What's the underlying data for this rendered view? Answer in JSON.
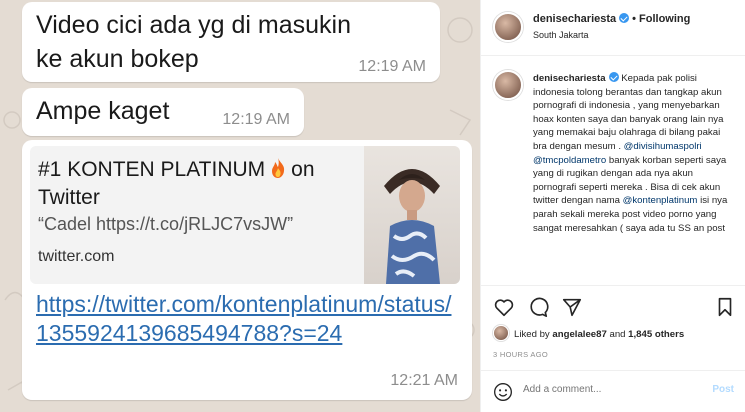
{
  "chat": {
    "messages": [
      {
        "text": "Video cici ada yg di masukin ke akun bokep",
        "time": "12:19 AM"
      },
      {
        "text": "Ampe kaget",
        "time": "12:19 AM"
      }
    ],
    "link_message": {
      "preview_title": "#1 KONTEN PLATINUM",
      "preview_title_suffix": "on Twitter",
      "preview_description": "“Cadel https://t.co/jRLJC7vsJW”",
      "preview_domain": "twitter.com",
      "url": "https://twitter.com/kontenplatinum/status/1355924139685494788?s=24",
      "time": "12:21 AM"
    }
  },
  "instagram": {
    "username": "denisechariesta",
    "separator": "•",
    "follow_status": "Following",
    "location": "South Jakarta",
    "caption": {
      "author": "denisechariesta",
      "part1": "Kepada pak polisi indonesia tolong berantas dan tangkap akun pornografi di indonesia , yang menyebarkan hoax konten saya dan banyak orang lain nya yang memakai baju olahraga di bilang pakai bra dengan mesum .",
      "mention1": "@divisihumaspolri",
      "mention2": "@tmcpoldametro",
      "part2": "banyak korban seperti saya yang di rugikan dengan ada nya akun pornografi seperti mereka . Bisa di cek akun twitter dengan nama",
      "mention3": "@kontenplatinum",
      "part3": "isi nya parah sekali mereka post video porno yang sangat meresahkan ( saya ada tu SS an post"
    },
    "likes": {
      "prefix": "Liked by",
      "user": "angelalee87",
      "middle": "and",
      "others": "1,845 others"
    },
    "time_ago": "3 HOURS AGO",
    "comment_placeholder": "Add a comment...",
    "post_label": "Post",
    "icons": [
      "heart-icon",
      "comment-icon",
      "share-icon",
      "bookmark-icon",
      "emoji-icon",
      "verified-badge-icon"
    ],
    "colors": {
      "link": "#2b6cb0",
      "verified": "#3897f0",
      "post_disabled": "#b3dbff",
      "chat_bg": "#e4dcd3"
    }
  }
}
